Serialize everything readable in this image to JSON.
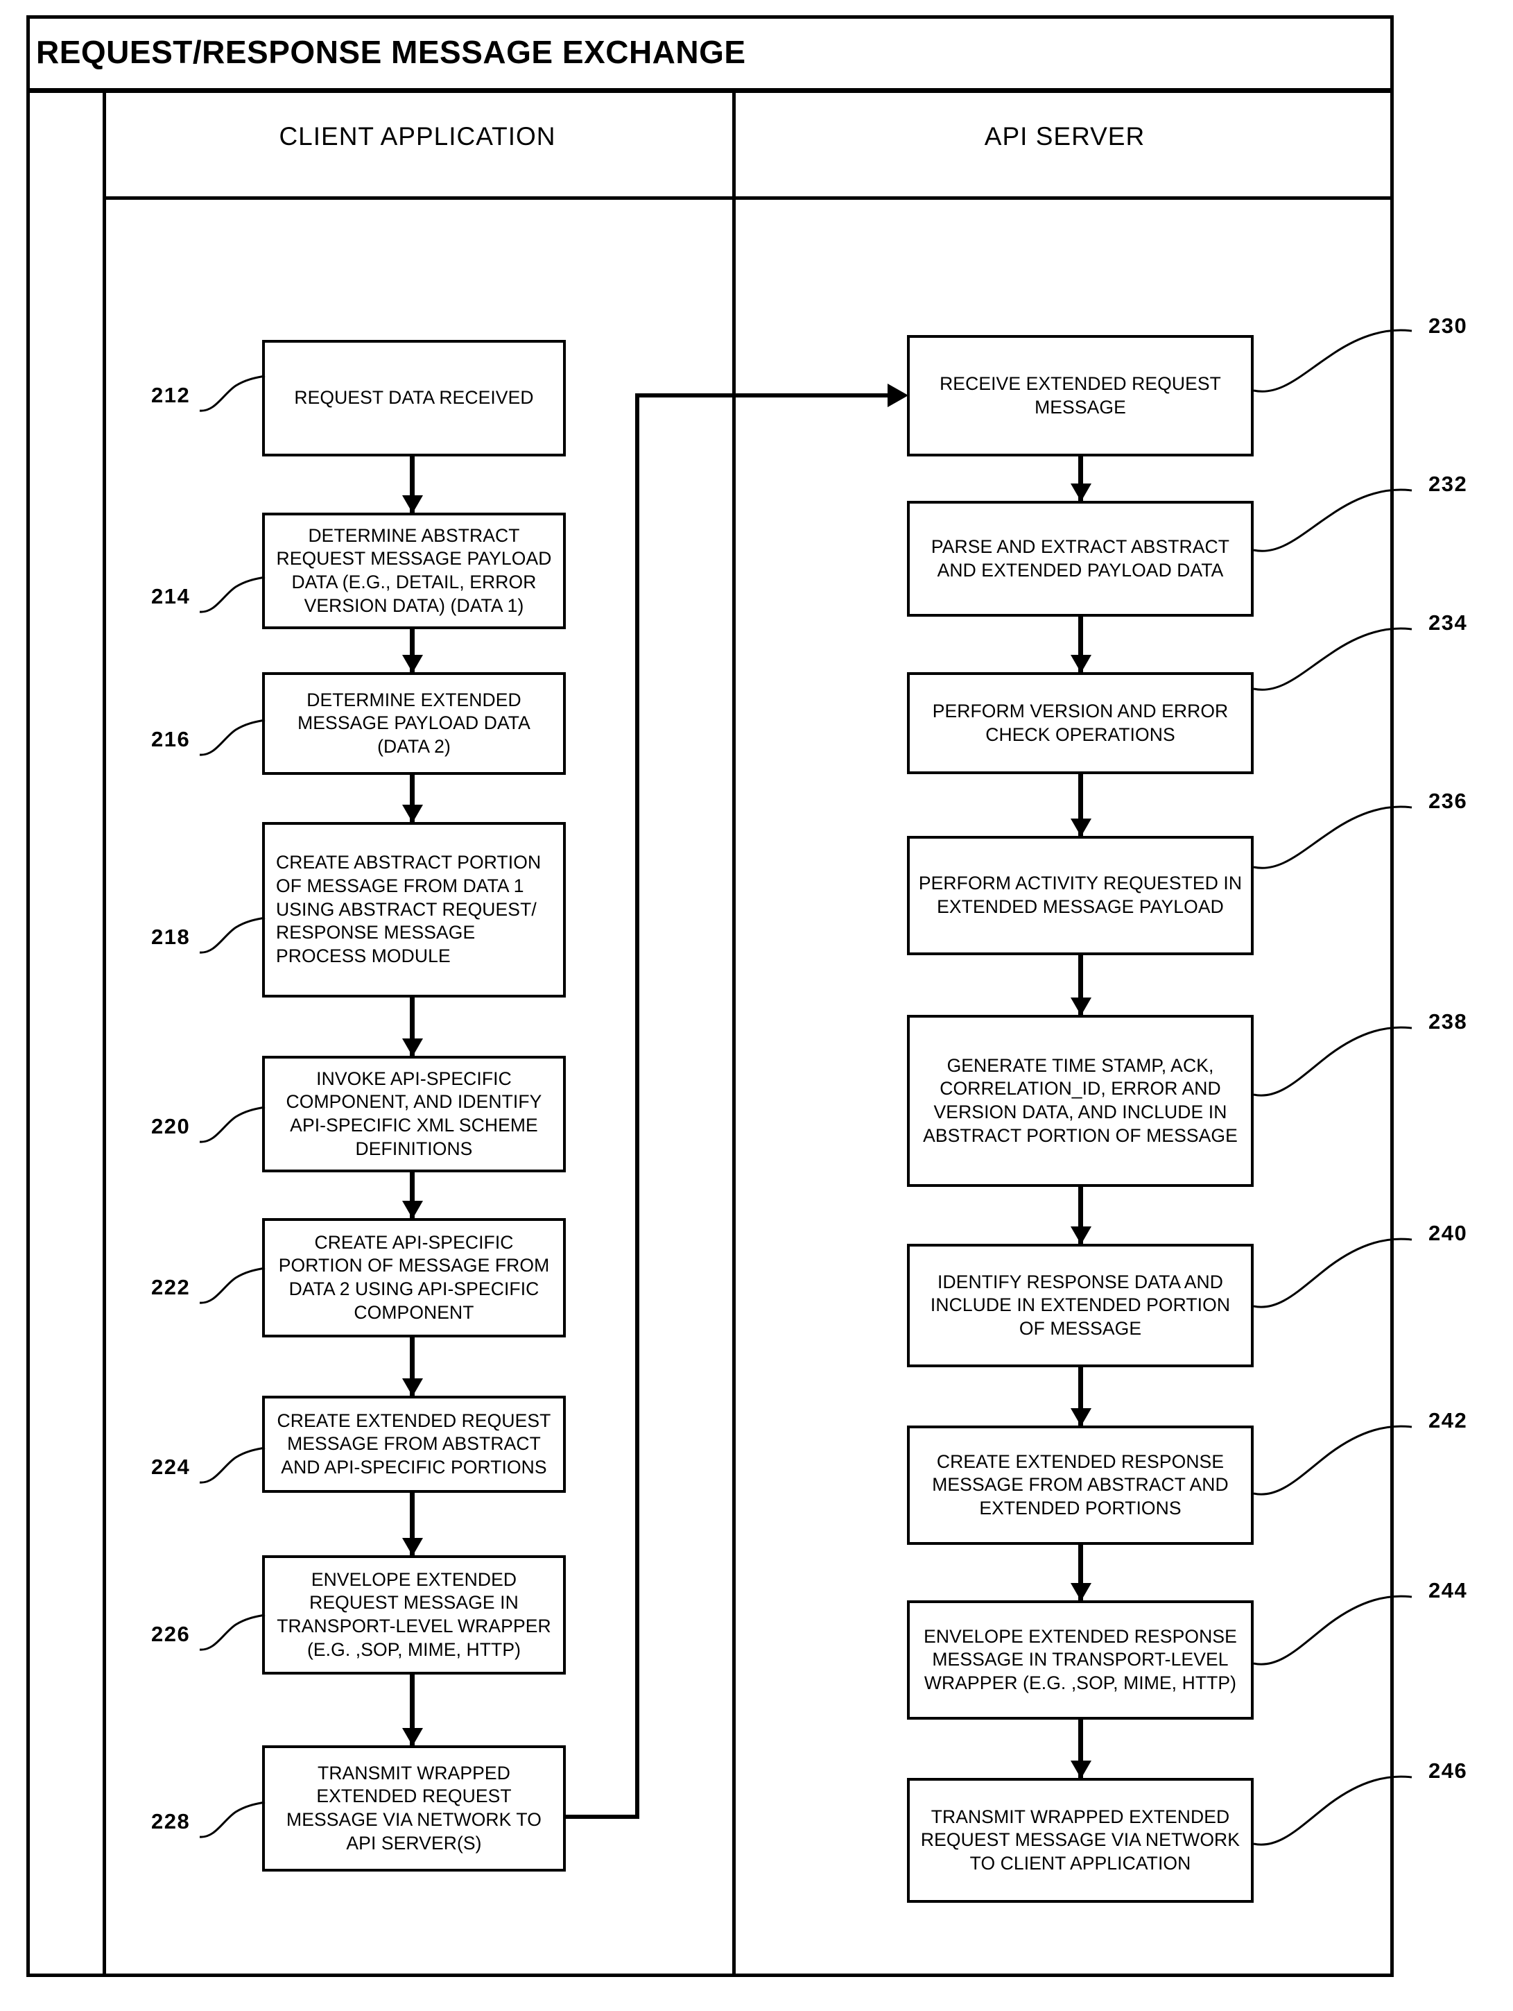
{
  "figure": {
    "title": "REQUEST/RESPONSE MESSAGE EXCHANGE"
  },
  "lanes": [
    {
      "id": "client",
      "label": "CLIENT APPLICATION"
    },
    {
      "id": "server",
      "label": "API SERVER"
    }
  ],
  "chart_data": {
    "type": "diagram",
    "diagram_kind": "swimlane-flowchart",
    "title": "REQUEST/RESPONSE MESSAGE EXCHANGE",
    "lanes": [
      "CLIENT APPLICATION",
      "API SERVER"
    ],
    "nodes": [
      {
        "ref": "212",
        "lane": "client",
        "text": "REQUEST DATA RECEIVED"
      },
      {
        "ref": "214",
        "lane": "client",
        "text": "DETERMINE ABSTRACT REQUEST MESSAGE PAYLOAD DATA (E.G., DETAIL, ERROR VERSION DATA) (DATA 1)"
      },
      {
        "ref": "216",
        "lane": "client",
        "text": "DETERMINE EXTENDED MESSAGE PAYLOAD DATA (DATA 2)"
      },
      {
        "ref": "218",
        "lane": "client",
        "text": "CREATE ABSTRACT PORTION OF MESSAGE FROM DATA 1 USING ABSTRACT REQUEST/ RESPONSE MESSAGE PROCESS MODULE"
      },
      {
        "ref": "220",
        "lane": "client",
        "text": "INVOKE API-SPECIFIC COMPONENT, AND IDENTIFY API-SPECIFIC XML SCHEME DEFINITIONS"
      },
      {
        "ref": "222",
        "lane": "client",
        "text": "CREATE API-SPECIFIC PORTION OF MESSAGE FROM DATA 2 USING API-SPECIFIC COMPONENT"
      },
      {
        "ref": "224",
        "lane": "client",
        "text": "CREATE EXTENDED REQUEST MESSAGE FROM ABSTRACT AND API-SPECIFIC PORTIONS"
      },
      {
        "ref": "226",
        "lane": "client",
        "text": "ENVELOPE EXTENDED REQUEST MESSAGE IN TRANSPORT-LEVEL WRAPPER (E.G. ,SOP, MIME, HTTP)"
      },
      {
        "ref": "228",
        "lane": "client",
        "text": "TRANSMIT WRAPPED EXTENDED REQUEST MESSAGE VIA NETWORK TO API SERVER(S)"
      },
      {
        "ref": "230",
        "lane": "server",
        "text": "RECEIVE EXTENDED REQUEST MESSAGE"
      },
      {
        "ref": "232",
        "lane": "server",
        "text": "PARSE AND EXTRACT ABSTRACT AND EXTENDED PAYLOAD DATA"
      },
      {
        "ref": "234",
        "lane": "server",
        "text": "PERFORM VERSION AND ERROR CHECK OPERATIONS"
      },
      {
        "ref": "236",
        "lane": "server",
        "text": "PERFORM ACTIVITY REQUESTED IN EXTENDED MESSAGE PAYLOAD"
      },
      {
        "ref": "238",
        "lane": "server",
        "text": "GENERATE TIME STAMP, ACK, CORRELATION_ID, ERROR AND VERSION DATA, AND INCLUDE IN ABSTRACT PORTION OF MESSAGE"
      },
      {
        "ref": "240",
        "lane": "server",
        "text": "IDENTIFY RESPONSE DATA AND INCLUDE IN EXTENDED PORTION OF MESSAGE"
      },
      {
        "ref": "242",
        "lane": "server",
        "text": "CREATE EXTENDED RESPONSE  MESSAGE FROM ABSTRACT AND EXTENDED PORTIONS"
      },
      {
        "ref": "244",
        "lane": "server",
        "text": "ENVELOPE EXTENDED RESPONSE MESSAGE IN TRANSPORT-LEVEL WRAPPER (E.G. ,SOP, MIME, HTTP)"
      },
      {
        "ref": "246",
        "lane": "server",
        "text": "TRANSMIT WRAPPED EXTENDED REQUEST MESSAGE VIA NETWORK TO CLIENT APPLICATION"
      }
    ],
    "edges": [
      {
        "from": "212",
        "to": "214"
      },
      {
        "from": "214",
        "to": "216"
      },
      {
        "from": "216",
        "to": "218"
      },
      {
        "from": "218",
        "to": "220"
      },
      {
        "from": "220",
        "to": "222"
      },
      {
        "from": "222",
        "to": "224"
      },
      {
        "from": "224",
        "to": "226"
      },
      {
        "from": "226",
        "to": "228"
      },
      {
        "from": "228",
        "to": "230",
        "style": "cross-lane"
      },
      {
        "from": "230",
        "to": "232"
      },
      {
        "from": "232",
        "to": "234"
      },
      {
        "from": "234",
        "to": "236"
      },
      {
        "from": "236",
        "to": "238"
      },
      {
        "from": "238",
        "to": "240"
      },
      {
        "from": "240",
        "to": "242"
      },
      {
        "from": "242",
        "to": "244"
      },
      {
        "from": "244",
        "to": "246"
      }
    ],
    "colors": {
      "line": "#000000",
      "background": "#ffffff",
      "text": "#000000"
    }
  },
  "boxes": {
    "b212": "REQUEST DATA RECEIVED",
    "b214": "DETERMINE ABSTRACT REQUEST MESSAGE PAYLOAD DATA (E.G., DETAIL, ERROR VERSION DATA) (DATA 1)",
    "b216": "DETERMINE EXTENDED MESSAGE PAYLOAD DATA (DATA 2)",
    "b218": "CREATE ABSTRACT PORTION OF MESSAGE FROM DATA 1 USING ABSTRACT REQUEST/ RESPONSE MESSAGE PROCESS MODULE",
    "b220": "INVOKE API-SPECIFIC COMPONENT, AND IDENTIFY API-SPECIFIC XML SCHEME DEFINITIONS",
    "b222": "CREATE API-SPECIFIC PORTION OF MESSAGE FROM DATA 2 USING API-SPECIFIC COMPONENT",
    "b224": "CREATE EXTENDED REQUEST MESSAGE FROM ABSTRACT AND API-SPECIFIC PORTIONS",
    "b226": "ENVELOPE EXTENDED REQUEST MESSAGE IN TRANSPORT-LEVEL WRAPPER (E.G. ,SOP, MIME, HTTP)",
    "b228": "TRANSMIT WRAPPED EXTENDED REQUEST MESSAGE VIA NETWORK TO API SERVER(S)",
    "b230": "RECEIVE EXTENDED REQUEST MESSAGE",
    "b232": "PARSE AND EXTRACT ABSTRACT AND EXTENDED PAYLOAD DATA",
    "b234": "PERFORM VERSION AND ERROR CHECK OPERATIONS",
    "b236": "PERFORM ACTIVITY REQUESTED IN EXTENDED MESSAGE PAYLOAD",
    "b238": "GENERATE TIME STAMP, ACK, CORRELATION_ID, ERROR AND VERSION DATA, AND INCLUDE IN ABSTRACT PORTION OF MESSAGE",
    "b240": "IDENTIFY RESPONSE DATA AND INCLUDE IN EXTENDED PORTION OF MESSAGE",
    "b242": "CREATE EXTENDED RESPONSE  MESSAGE FROM ABSTRACT AND EXTENDED PORTIONS",
    "b244": "ENVELOPE EXTENDED RESPONSE MESSAGE IN TRANSPORT-LEVEL WRAPPER (E.G. ,SOP, MIME, HTTP)",
    "b246": "TRANSMIT WRAPPED EXTENDED REQUEST MESSAGE VIA NETWORK TO CLIENT APPLICATION"
  },
  "refs": {
    "r212": "212",
    "r214": "214",
    "r216": "216",
    "r218": "218",
    "r220": "220",
    "r222": "222",
    "r224": "224",
    "r226": "226",
    "r228": "228",
    "r230": "230",
    "r232": "232",
    "r234": "234",
    "r236": "236",
    "r238": "238",
    "r240": "240",
    "r242": "242",
    "r244": "244",
    "r246": "246"
  }
}
